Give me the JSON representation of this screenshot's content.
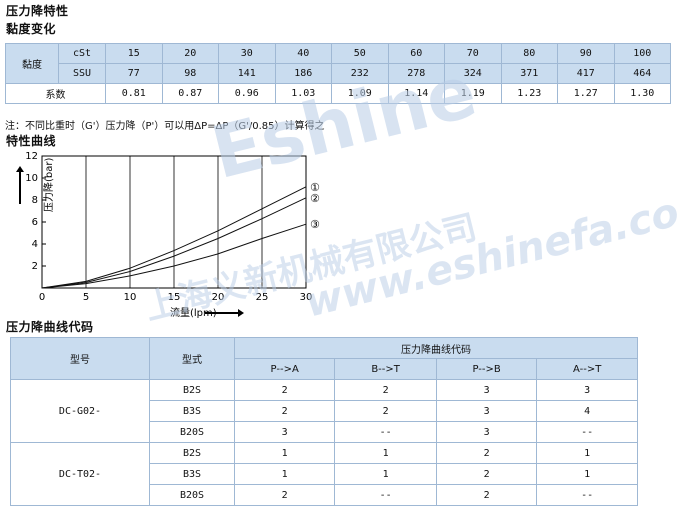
{
  "title": "压力降特性",
  "viscosity_title": "黏度变化",
  "viscosity_table": {
    "row_label": "黏度",
    "units": [
      "cSt",
      "SSU"
    ],
    "cst": [
      "15",
      "20",
      "30",
      "40",
      "50",
      "60",
      "70",
      "80",
      "90",
      "100"
    ],
    "ssu": [
      "77",
      "98",
      "141",
      "186",
      "232",
      "278",
      "324",
      "371",
      "417",
      "464"
    ],
    "coef_label": "系数",
    "coef": [
      "0.81",
      "0.87",
      "0.96",
      "1.03",
      "1.09",
      "1.14",
      "1.19",
      "1.23",
      "1.27",
      "1.30"
    ]
  },
  "note": "注：不同比重时（G'）压力降（P'）可以用ΔP=ΔP（G'/0.85）计算得之",
  "curve_title": "特性曲线",
  "chart_data": {
    "type": "line",
    "xlabel": "流量(lpm)",
    "ylabel": "压力降(bar)",
    "x_ticks": [
      "0",
      "5",
      "10",
      "15",
      "20",
      "25",
      "30"
    ],
    "y_ticks": [
      "2",
      "4",
      "6",
      "8",
      "10",
      "12"
    ],
    "xlim": [
      0,
      30
    ],
    "ylim": [
      0,
      12
    ],
    "series": [
      {
        "name": "①",
        "x": [
          0,
          5,
          10,
          15,
          20,
          25,
          30
        ],
        "y": [
          0,
          0.6,
          1.8,
          3.4,
          5.2,
          7.2,
          9.2
        ]
      },
      {
        "name": "②",
        "x": [
          0,
          5,
          10,
          15,
          20,
          25,
          30
        ],
        "y": [
          0,
          0.5,
          1.5,
          2.9,
          4.5,
          6.3,
          8.2
        ]
      },
      {
        "name": "③",
        "x": [
          0,
          5,
          10,
          15,
          20,
          25,
          30
        ],
        "y": [
          0,
          0.4,
          1.1,
          2.0,
          3.1,
          4.5,
          5.8
        ]
      }
    ]
  },
  "code_title": "压力降曲线代码",
  "code_table": {
    "col_model": "型号",
    "col_type": "型式",
    "col_code": "压力降曲线代码",
    "directions": [
      "P-->A",
      "B-->T",
      "P-->B",
      "A-->T"
    ],
    "groups": [
      {
        "model": "DC-G02-",
        "rows": [
          {
            "type": "B2S",
            "vals": [
              "2",
              "2",
              "3",
              "3"
            ]
          },
          {
            "type": "B3S",
            "vals": [
              "2",
              "2",
              "3",
              "4"
            ]
          },
          {
            "type": "B20S",
            "vals": [
              "3",
              "--",
              "3",
              "--"
            ]
          }
        ]
      },
      {
        "model": "DC-T02-",
        "rows": [
          {
            "type": "B2S",
            "vals": [
              "1",
              "1",
              "2",
              "1"
            ]
          },
          {
            "type": "B3S",
            "vals": [
              "1",
              "1",
              "2",
              "1"
            ]
          },
          {
            "type": "B20S",
            "vals": [
              "2",
              "--",
              "2",
              "--"
            ]
          }
        ]
      }
    ]
  },
  "watermark": {
    "brand": "Eshine",
    "company": "上海义新机械有限公司",
    "url": "www.eshinefa.com"
  }
}
